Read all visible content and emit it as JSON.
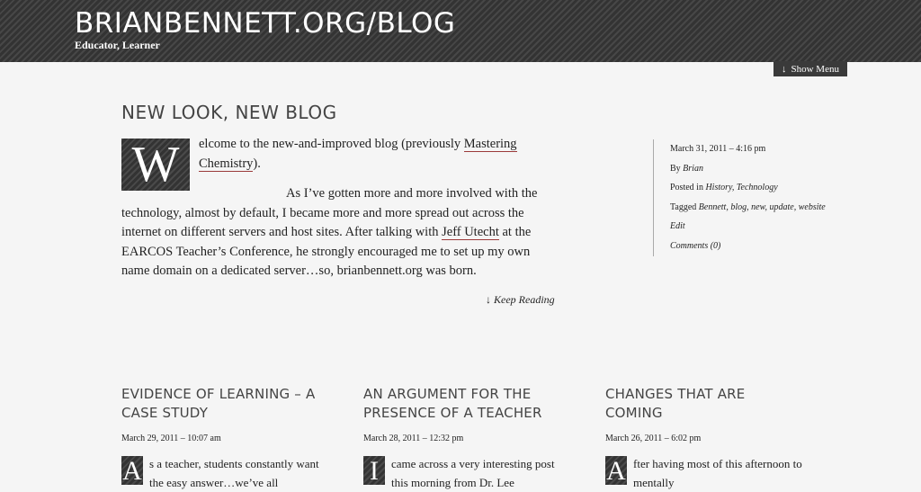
{
  "header": {
    "site_title": "BRIANBENNETT.ORG/BLOG",
    "tagline": "Educator, Learner",
    "menu_arrow": "↓",
    "menu_label": "Show Menu"
  },
  "post": {
    "title": "NEW LOOK, NEW BLOG",
    "dropcap": "W",
    "p1_text": "elcome to the new-and-improved blog (previously ",
    "p1_link": "Mastering Chemistry",
    "p1_end": ").",
    "p2_text": "As I’ve gotten more and more involved with the technology, almost by default, I became more and more spread out across the internet on different servers and host sites. After talking with ",
    "p2_link": "Jeff Utecht",
    "p2_end": " at the EARCOS Teacher’s Conference, he strongly encouraged me to set up my own name domain on a dedicated server…so, brianbennett.org was born.",
    "keep_reading_arrow": "↓",
    "keep_reading": "Keep Reading",
    "meta": {
      "date": "March 31, 2011 – 4:16 pm",
      "by_label": "By",
      "author": "Brian",
      "posted_label": "Posted in",
      "categories": [
        "History",
        "Technology"
      ],
      "tagged_label": "Tagged",
      "tags": [
        "Bennett",
        "blog",
        "new",
        "update",
        "website"
      ],
      "edit": "Edit",
      "comments": "Comments (0)"
    }
  },
  "recent_posts": [
    {
      "title_line1": "EVIDENCE OF LEARNING – A",
      "title_line2": "CASE STUDY",
      "date": "March 29, 2011 – 10:07 am",
      "cap": "A",
      "excerpt": "s a teacher, students constantly want the easy answer…we’ve all"
    },
    {
      "title_line1": "AN ARGUMENT FOR THE",
      "title_line2": "PRESENCE OF A TEACHER",
      "date": "March 28, 2011 – 12:32 pm",
      "cap": "I",
      "excerpt": "came across a very interesting post this morning from Dr. Lee"
    },
    {
      "title_line1": "CHANGES THAT ARE",
      "title_line2": "COMING",
      "date": "March 26, 2011 – 6:02 pm",
      "cap": "A",
      "excerpt": "fter having most of this afternoon to mentally"
    }
  ]
}
